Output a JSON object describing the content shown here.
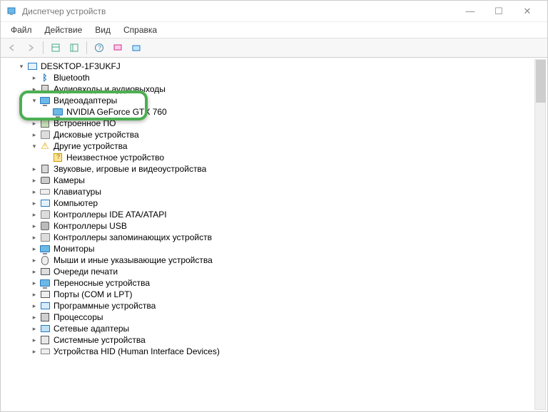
{
  "window": {
    "title": "Диспетчер устройств"
  },
  "menu": {
    "file": "Файл",
    "action": "Действие",
    "view": "Вид",
    "help": "Справка"
  },
  "tree": {
    "root": "DESKTOP-1F3UKFJ",
    "items": [
      {
        "label": "Bluetooth",
        "icon": "bt",
        "expanded": false,
        "children": []
      },
      {
        "label": "Аудиовходы и аудиовыходы",
        "icon": "speaker",
        "expanded": false,
        "children": []
      },
      {
        "label": "Видеоадаптеры",
        "icon": "monitor",
        "expanded": true,
        "highlighted": true,
        "children": [
          {
            "label": "NVIDIA GeForce GTX 760",
            "icon": "monitor",
            "highlighted": true
          }
        ]
      },
      {
        "label": "Встроенное ПО",
        "icon": "chip",
        "expanded": false,
        "children": []
      },
      {
        "label": "Дисковые устройства",
        "icon": "disk",
        "expanded": false,
        "children": []
      },
      {
        "label": "Другие устройства",
        "icon": "warn",
        "expanded": true,
        "children": [
          {
            "label": "Неизвестное устройство",
            "icon": "unknown"
          }
        ]
      },
      {
        "label": "Звуковые, игровые и видеоустройства",
        "icon": "speaker",
        "expanded": false,
        "children": []
      },
      {
        "label": "Камеры",
        "icon": "cam",
        "expanded": false,
        "children": []
      },
      {
        "label": "Клавиатуры",
        "icon": "keyboard",
        "expanded": false,
        "children": []
      },
      {
        "label": "Компьютер",
        "icon": "pc",
        "expanded": false,
        "children": []
      },
      {
        "label": "Контроллеры IDE ATA/ATAPI",
        "icon": "disk",
        "expanded": false,
        "children": []
      },
      {
        "label": "Контроллеры USB",
        "icon": "usb",
        "expanded": false,
        "children": []
      },
      {
        "label": "Контроллеры запоминающих устройств",
        "icon": "disk",
        "expanded": false,
        "children": []
      },
      {
        "label": "Мониторы",
        "icon": "monitor",
        "expanded": false,
        "children": []
      },
      {
        "label": "Мыши и иные указывающие устройства",
        "icon": "mouse",
        "expanded": false,
        "children": []
      },
      {
        "label": "Очереди печати",
        "icon": "printer",
        "expanded": false,
        "children": []
      },
      {
        "label": "Переносные устройства",
        "icon": "monitor",
        "expanded": false,
        "children": []
      },
      {
        "label": "Порты (COM и LPT)",
        "icon": "port",
        "expanded": false,
        "children": []
      },
      {
        "label": "Программные устройства",
        "icon": "sw",
        "expanded": false,
        "children": []
      },
      {
        "label": "Процессоры",
        "icon": "cpu",
        "expanded": false,
        "children": []
      },
      {
        "label": "Сетевые адаптеры",
        "icon": "net",
        "expanded": false,
        "children": []
      },
      {
        "label": "Системные устройства",
        "icon": "sys",
        "expanded": false,
        "children": []
      },
      {
        "label": "Устройства HID (Human Interface Devices)",
        "icon": "hid",
        "expanded": false,
        "children": []
      }
    ]
  }
}
